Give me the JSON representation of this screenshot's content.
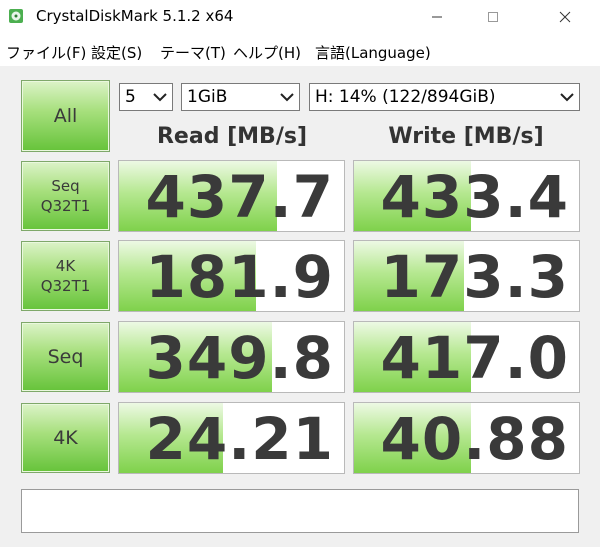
{
  "window": {
    "title": "CrystalDiskMark 5.1.2 x64",
    "minimize_glyph": "—",
    "maximize_glyph": "☐",
    "close_glyph": "✕"
  },
  "menu": [
    {
      "label": "ファイル(F)"
    },
    {
      "label": "設定(S)"
    },
    {
      "label": "テーマ(T)"
    },
    {
      "label": "ヘルプ(H)"
    },
    {
      "label": "言語(Language)"
    }
  ],
  "controls": {
    "all_label": "All",
    "count_value": "5",
    "size_value": "1GiB",
    "drive_value": "H: 14% (122/894GiB)"
  },
  "headers": {
    "read": "Read [MB/s]",
    "write": "Write [MB/s]"
  },
  "rows": [
    {
      "line1": "Seq",
      "line2": "Q32T1",
      "read": "437.7",
      "write": "433.4",
      "read_level": 0.7,
      "write_level": 0.52
    },
    {
      "line1": "4K",
      "line2": "Q32T1",
      "read": "181.9",
      "write": "173.3",
      "read_level": 0.61,
      "write_level": 0.49
    },
    {
      "line1": "Seq",
      "line2": "",
      "read": "349.8",
      "write": "417.0",
      "read_level": 0.68,
      "write_level": 0.52
    },
    {
      "line1": "4K",
      "line2": "",
      "read": "24.21",
      "write": "40.88",
      "read_level": 0.46,
      "write_level": 0.52
    }
  ],
  "comment": "",
  "colors": {
    "accent_green": "#66c33a",
    "value_text": "#3a3a3a"
  }
}
